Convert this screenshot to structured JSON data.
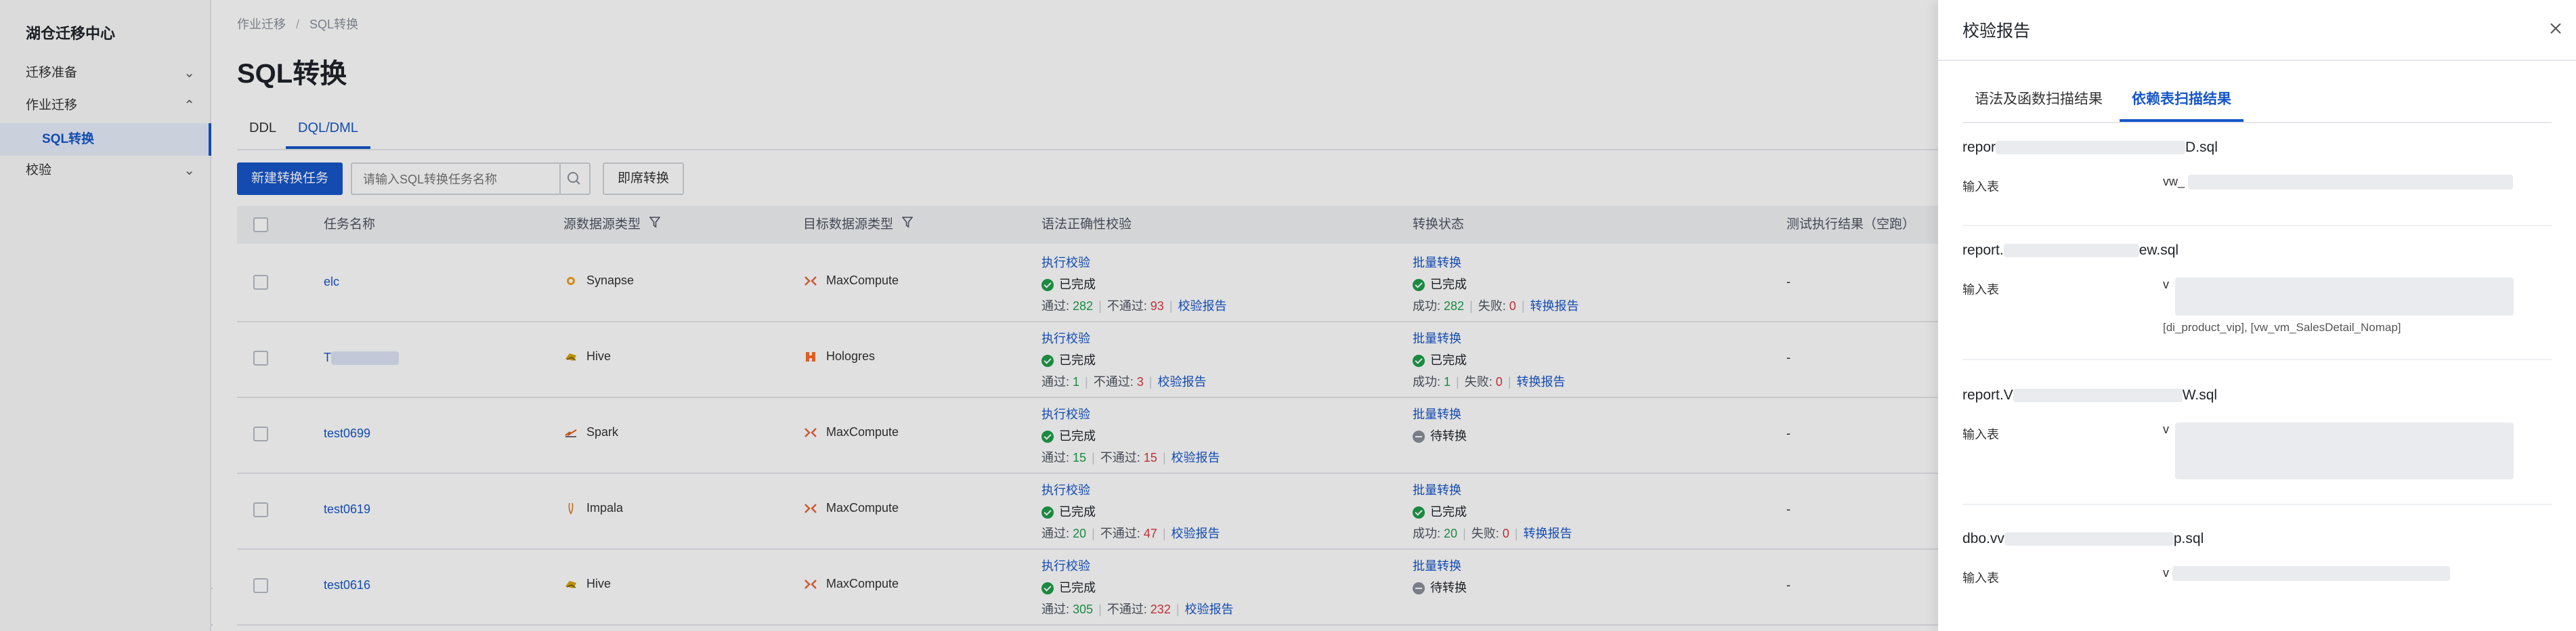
{
  "sidebar": {
    "brand": "湖仓迁移中心",
    "items": [
      {
        "label": "迁移准备",
        "chevron": "⌄"
      },
      {
        "label": "作业迁移",
        "chevron": "⌃"
      },
      {
        "label": "SQL转换"
      },
      {
        "label": "校验",
        "chevron": "⌄"
      }
    ],
    "collapse_glyph": "‹"
  },
  "breadcrumb": [
    "作业迁移",
    "/",
    "SQL转换"
  ],
  "page_title": "SQL转换",
  "tabs": [
    {
      "label": "DDL"
    },
    {
      "label": "DQL/DML"
    }
  ],
  "toolbar": {
    "new_task": "新建转换任务",
    "search_placeholder": "请输入SQL转换任务名称",
    "instant": "即席转换"
  },
  "table": {
    "headers": [
      "任务名称",
      "源数据源类型",
      "目标数据源类型",
      "语法正确性校验",
      "转换状态",
      "测试执行结果（空跑）"
    ],
    "rows": [
      {
        "name": "elc",
        "src": "Synapse",
        "dst": "MaxCompute",
        "check": {
          "action": "执行校验",
          "status": "已完成",
          "pass_label": "通过:",
          "pass": "282",
          "fail_label": "不通过:",
          "fail": "93",
          "report": "校验报告"
        },
        "conv": {
          "action": "批量转换",
          "status": "已完成",
          "done": true,
          "succ_label": "成功:",
          "succ": "282",
          "fail_label": "失败:",
          "fail": "0",
          "report": "转换报告"
        },
        "test": "-"
      },
      {
        "name": "T",
        "src": "Hive",
        "dst": "Hologres",
        "check": {
          "action": "执行校验",
          "status": "已完成",
          "pass_label": "通过:",
          "pass": "1",
          "fail_label": "不通过:",
          "fail": "3",
          "report": "校验报告"
        },
        "conv": {
          "action": "批量转换",
          "status": "已完成",
          "done": true,
          "succ_label": "成功:",
          "succ": "1",
          "fail_label": "失败:",
          "fail": "0",
          "report": "转换报告"
        },
        "test": "-"
      },
      {
        "name": "test0699",
        "src": "Spark",
        "dst": "MaxCompute",
        "check": {
          "action": "执行校验",
          "status": "已完成",
          "pass_label": "通过:",
          "pass": "15",
          "fail_label": "不通过:",
          "fail": "15",
          "report": "校验报告"
        },
        "conv": {
          "action": "批量转换",
          "status": "待转换",
          "done": false
        },
        "test": "-"
      },
      {
        "name": "test0619",
        "src": "Impala",
        "dst": "MaxCompute",
        "check": {
          "action": "执行校验",
          "status": "已完成",
          "pass_label": "通过:",
          "pass": "20",
          "fail_label": "不通过:",
          "fail": "47",
          "report": "校验报告"
        },
        "conv": {
          "action": "批量转换",
          "status": "已完成",
          "done": true,
          "succ_label": "成功:",
          "succ": "20",
          "fail_label": "失败:",
          "fail": "0",
          "report": "转换报告"
        },
        "test": "-"
      },
      {
        "name": "test0616",
        "src": "Hive",
        "dst": "MaxCompute",
        "check": {
          "action": "执行校验",
          "status": "已完成",
          "pass_label": "通过:",
          "pass": "305",
          "fail_label": "不通过:",
          "fail": "232",
          "report": "校验报告"
        },
        "conv": {
          "action": "批量转换",
          "status": "待转换",
          "done": false
        },
        "test": "-"
      }
    ]
  },
  "drawer": {
    "title": "校验报告",
    "tabs": [
      {
        "label": "语法及函数扫描结果"
      },
      {
        "label": "依赖表扫描结果"
      }
    ],
    "reports": [
      {
        "file_start": "repor",
        "file_end": "D.sql",
        "label": "输入表",
        "value_start": "vw_"
      },
      {
        "file_start": "report.",
        "file_end": "ew.sql",
        "label": "输入表",
        "value_start": "v",
        "value_line2": "[di_product_vip], [vw_vm_SalesDetail_Nomap]"
      },
      {
        "file_start": "report.V",
        "file_end": "W.sql",
        "label": "输入表",
        "value_start": "v"
      },
      {
        "file_start": "dbo.vv",
        "file_end": "p.sql",
        "label": "输入表",
        "value_start": "v"
      }
    ]
  },
  "colors": {
    "accent": "#1656c9",
    "success": "#1e9e4a",
    "danger": "#d9363e",
    "muted": "#8a8f99"
  },
  "icons": {
    "synapse": "synapse-icon",
    "hive": "hive-icon",
    "spark": "spark-icon",
    "impala": "impala-icon",
    "maxcompute": "maxcompute-icon",
    "hologres": "hologres-icon",
    "filter": "filter-icon",
    "search": "search-icon",
    "close": "close-icon",
    "check": "check-circle-icon",
    "pending": "pending-circle-icon"
  }
}
